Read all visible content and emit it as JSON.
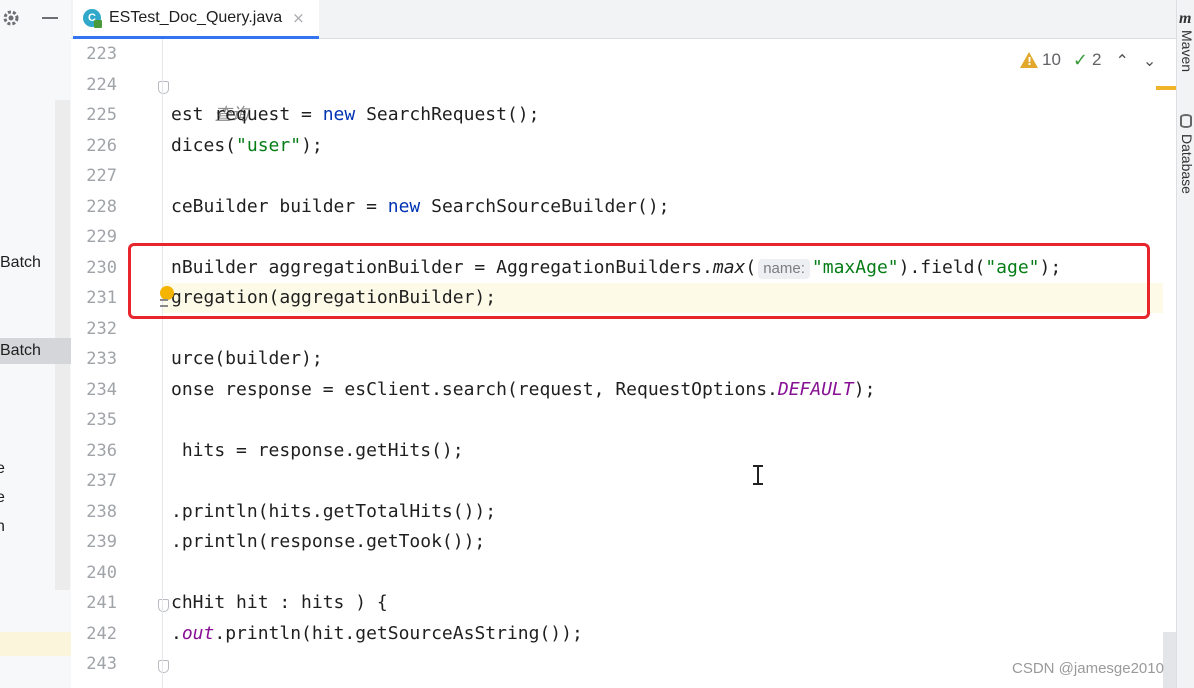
{
  "left_panel": {
    "items": [
      "Batch",
      "Batch",
      "e",
      "e",
      "n"
    ]
  },
  "tab": {
    "class_icon_letter": "C",
    "title": "ESTest_Doc_Query.java",
    "close": "×"
  },
  "inspections": {
    "warnings": "10",
    "typos": "2",
    "prev": "⌃",
    "next": "⌄"
  },
  "side_tools": {
    "maven": "Maven",
    "maven_icon": "m",
    "database": "Database"
  },
  "gutter": {
    "line_numbers": [
      "223",
      "224",
      "225",
      "226",
      "227",
      "228",
      "229",
      "230",
      "231",
      "232",
      "233",
      "234",
      "235",
      "236",
      "237",
      "238",
      "239",
      "240",
      "241",
      "242",
      "243"
    ]
  },
  "code": {
    "l224": "查询",
    "l225a": "est request = ",
    "l225b": "new",
    "l225c": " SearchRequest();",
    "l226a": "dices(",
    "l226b": "\"user\"",
    "l226c": ");",
    "l228a": "ceBuilder builder = ",
    "l228b": "new",
    "l228c": " SearchSourceBuilder();",
    "l230a": "nBuilder aggregationBuilder = AggregationBuilders.",
    "l230b": "max",
    "l230c": "(",
    "l230_hint": "name:",
    "l230d": "\"maxAge\"",
    "l230e": ").field(",
    "l230f": "\"age\"",
    "l230g": ");",
    "l231": "gregation(aggregationBuilder);",
    "l233": "urce(builder);",
    "l234a": "onse response = esClient.search(request, RequestOptions.",
    "l234b": "DEFAULT",
    "l234c": ");",
    "l236": " hits = response.getHits();",
    "l238": ".println(hits.getTotalHits());",
    "l239": ".println(response.getTook());",
    "l241": "chHit hit : hits ) {",
    "l242a": ".",
    "l242b": "out",
    "l242c": ".println(hit.getSourceAsString());"
  },
  "watermark": "CSDN @jamesge2010",
  "colors": {
    "keyword": "#0033b3",
    "string": "#067d17",
    "constant": "#871094",
    "annotation_box": "#e8242c",
    "tab_underline": "#3574f0"
  }
}
